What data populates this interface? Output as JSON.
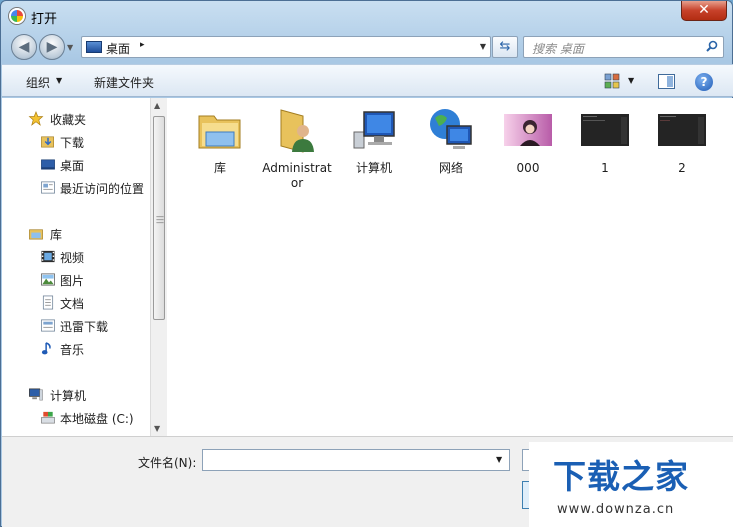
{
  "window": {
    "title": "打开",
    "close_label": "✕"
  },
  "address": {
    "location": "桌面",
    "arrow": "▸"
  },
  "search": {
    "placeholder": "搜索 桌面"
  },
  "toolbar": {
    "organize": "组织",
    "new_folder": "新建文件夹",
    "help": "?"
  },
  "nav": {
    "favorites": {
      "label": "收藏夹",
      "items": [
        "下载",
        "桌面",
        "最近访问的位置"
      ]
    },
    "libraries": {
      "label": "库",
      "items": [
        "视频",
        "图片",
        "文档",
        "迅雷下载",
        "音乐"
      ]
    },
    "computer": {
      "label": "计算机",
      "items": [
        "本地磁盘 (C:)"
      ]
    }
  },
  "files": [
    {
      "name": "库",
      "icon": "library-icon"
    },
    {
      "name": "Administrator",
      "icon": "user-folder-icon"
    },
    {
      "name": "计算机",
      "icon": "computer-icon"
    },
    {
      "name": "网络",
      "icon": "network-icon"
    },
    {
      "name": "000",
      "icon": "image-thumbnail"
    },
    {
      "name": "1",
      "icon": "dark-screenshot-thumbnail"
    },
    {
      "name": "2",
      "icon": "dark-screenshot-thumbnail"
    }
  ],
  "filename": {
    "label": "文件名(N):",
    "value": ""
  },
  "watermark": {
    "main": "下载之家",
    "sub": "www.downza.cn"
  },
  "colors": {
    "accent": "#1a5fb4",
    "window_frame": "#a9c8e4"
  }
}
